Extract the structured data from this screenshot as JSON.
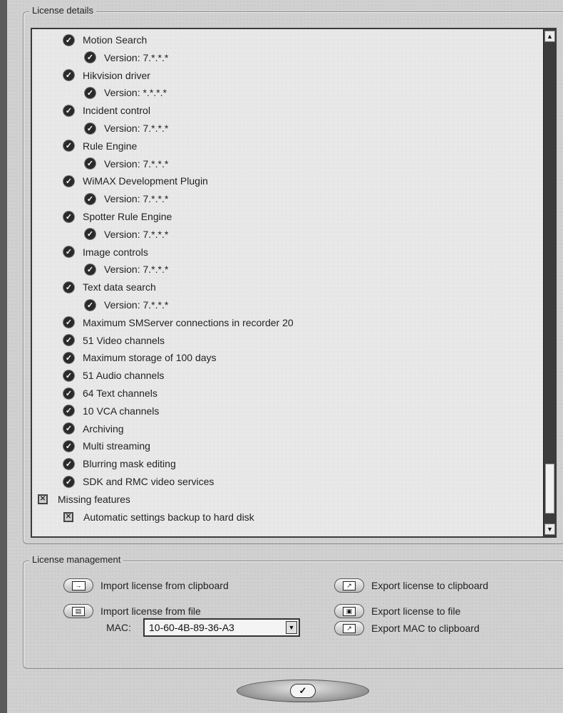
{
  "license_details": {
    "title": "License details",
    "items": [
      {
        "label": "Motion Search",
        "status": "check",
        "level": 1
      },
      {
        "label": "Version: 7.*.*.*",
        "status": "check",
        "level": 2
      },
      {
        "label": "Hikvision driver",
        "status": "check",
        "level": 1
      },
      {
        "label": "Version: *.*.*.*",
        "status": "check",
        "level": 2
      },
      {
        "label": "Incident control",
        "status": "check",
        "level": 1
      },
      {
        "label": "Version: 7.*.*.*",
        "status": "check",
        "level": 2
      },
      {
        "label": "Rule Engine",
        "status": "check",
        "level": 1
      },
      {
        "label": "Version: 7.*.*.*",
        "status": "check",
        "level": 2
      },
      {
        "label": "WiMAX Development Plugin",
        "status": "check",
        "level": 1
      },
      {
        "label": "Version: 7.*.*.*",
        "status": "check",
        "level": 2
      },
      {
        "label": "Spotter Rule Engine",
        "status": "check",
        "level": 1
      },
      {
        "label": "Version: 7.*.*.*",
        "status": "check",
        "level": 2
      },
      {
        "label": "Image controls",
        "status": "check",
        "level": 1
      },
      {
        "label": "Version: 7.*.*.*",
        "status": "check",
        "level": 2
      },
      {
        "label": "Text data search",
        "status": "check",
        "level": 1
      },
      {
        "label": "Version: 7.*.*.*",
        "status": "check",
        "level": 2
      },
      {
        "label": "Maximum SMServer connections in recorder 20",
        "status": "check",
        "level": 1
      },
      {
        "label": "51 Video channels",
        "status": "check",
        "level": 1
      },
      {
        "label": "Maximum storage of 100 days",
        "status": "check",
        "level": 1
      },
      {
        "label": "51 Audio channels",
        "status": "check",
        "level": 1
      },
      {
        "label": "64 Text channels",
        "status": "check",
        "level": 1
      },
      {
        "label": "10 VCA channels",
        "status": "check",
        "level": 1
      },
      {
        "label": "Archiving",
        "status": "check",
        "level": 1
      },
      {
        "label": "Multi streaming",
        "status": "check",
        "level": 1
      },
      {
        "label": "Blurring mask editing",
        "status": "check",
        "level": 1
      },
      {
        "label": "SDK and RMC video services",
        "status": "check",
        "level": 1
      },
      {
        "label": "Missing features",
        "status": "missing",
        "level": 0
      },
      {
        "label": "Automatic settings backup to hard disk",
        "status": "missing",
        "level": 1
      }
    ]
  },
  "license_management": {
    "title": "License management",
    "import_clipboard": "Import license from clipboard",
    "import_file": "Import license from file",
    "export_clipboard": "Export license to clipboard",
    "export_file": "Export license to file",
    "export_mac": "Export MAC to clipboard",
    "mac_label": "MAC:",
    "mac_value": "10-60-4B-89-36-A3"
  },
  "ok_button": {
    "icon": "check-icon"
  },
  "colors": {
    "panel": "#d0d0d0",
    "list_bg": "#e8e8e8",
    "scrollbar": "#3c3c3c"
  }
}
